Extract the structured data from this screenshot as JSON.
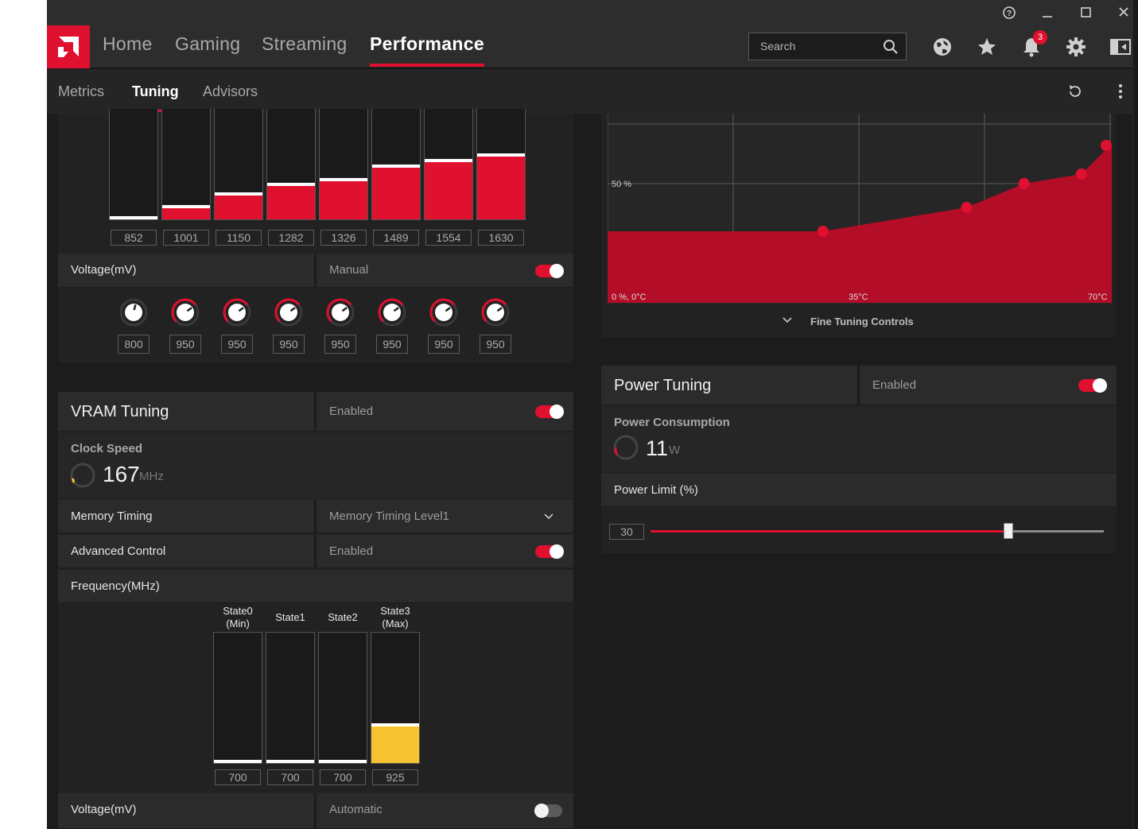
{
  "window": {
    "help_icon": "?",
    "minimize_icon": "–",
    "maximize_icon": "□",
    "close_icon": "✕"
  },
  "nav": {
    "tabs": [
      {
        "label": "Home"
      },
      {
        "label": "Gaming"
      },
      {
        "label": "Streaming"
      },
      {
        "label": "Performance"
      }
    ],
    "active_tab": "Performance",
    "search_placeholder": "Search",
    "notification_count": "3"
  },
  "subnav": {
    "tabs": [
      {
        "label": "Metrics"
      },
      {
        "label": "Tuning"
      },
      {
        "label": "Advisors"
      }
    ],
    "active_tab": "Tuning"
  },
  "gpu": {
    "frequency_values": [
      "852",
      "1001",
      "1150",
      "1282",
      "1326",
      "1489",
      "1554",
      "1630"
    ],
    "frequency_fill_fraction": [
      0.03,
      0.13,
      0.24,
      0.33,
      0.37,
      0.49,
      0.54,
      0.59
    ],
    "voltage_label": "Voltage(mV)",
    "voltage_mode": "Manual",
    "voltage_enabled": true,
    "voltage_values": [
      "800",
      "950",
      "950",
      "950",
      "950",
      "950",
      "950",
      "950"
    ]
  },
  "vram": {
    "title": "VRAM Tuning",
    "status": "Enabled",
    "enabled": true,
    "clock_label": "Clock Speed",
    "clock_value": "167",
    "clock_unit": "MHz",
    "memory_timing_label": "Memory Timing",
    "memory_timing_value": "Memory Timing Level1",
    "advanced_label": "Advanced Control",
    "advanced_status": "Enabled",
    "advanced_enabled": true,
    "frequency_label": "Frequency(MHz)",
    "states": [
      {
        "name": "State0\n(Min)",
        "value": "700",
        "fill": 0.02
      },
      {
        "name": "State1",
        "value": "700",
        "fill": 0.02
      },
      {
        "name": "State2",
        "value": "700",
        "fill": 0.02
      },
      {
        "name": "State3\n(Max)",
        "value": "925",
        "fill": 0.3
      }
    ],
    "voltage_label": "Voltage(mV)",
    "voltage_mode": "Automatic",
    "voltage_enabled": false
  },
  "fan": {
    "y_label_mid": "50 %",
    "x_label_start": "0 %, 0°C",
    "x_label_mid": "35°C",
    "x_label_end": "70°C",
    "fine_tuning_label": "Fine Tuning Controls",
    "curve_points": [
      {
        "temp": 0,
        "speed": 30
      },
      {
        "temp": 30,
        "speed": 30
      },
      {
        "temp": 50,
        "speed": 40
      },
      {
        "temp": 58,
        "speed": 50
      },
      {
        "temp": 66,
        "speed": 54
      },
      {
        "temp": 70,
        "speed": 66
      }
    ]
  },
  "power": {
    "title": "Power Tuning",
    "status": "Enabled",
    "enabled": true,
    "consumption_label": "Power Consumption",
    "consumption_value": "11",
    "consumption_unit": "W",
    "limit_label": "Power Limit (%)",
    "limit_value": "30",
    "limit_fraction": 0.79
  },
  "colors": {
    "accent": "#e0102f",
    "vram_accent": "#f5c231",
    "background": "#1c1c1c"
  }
}
